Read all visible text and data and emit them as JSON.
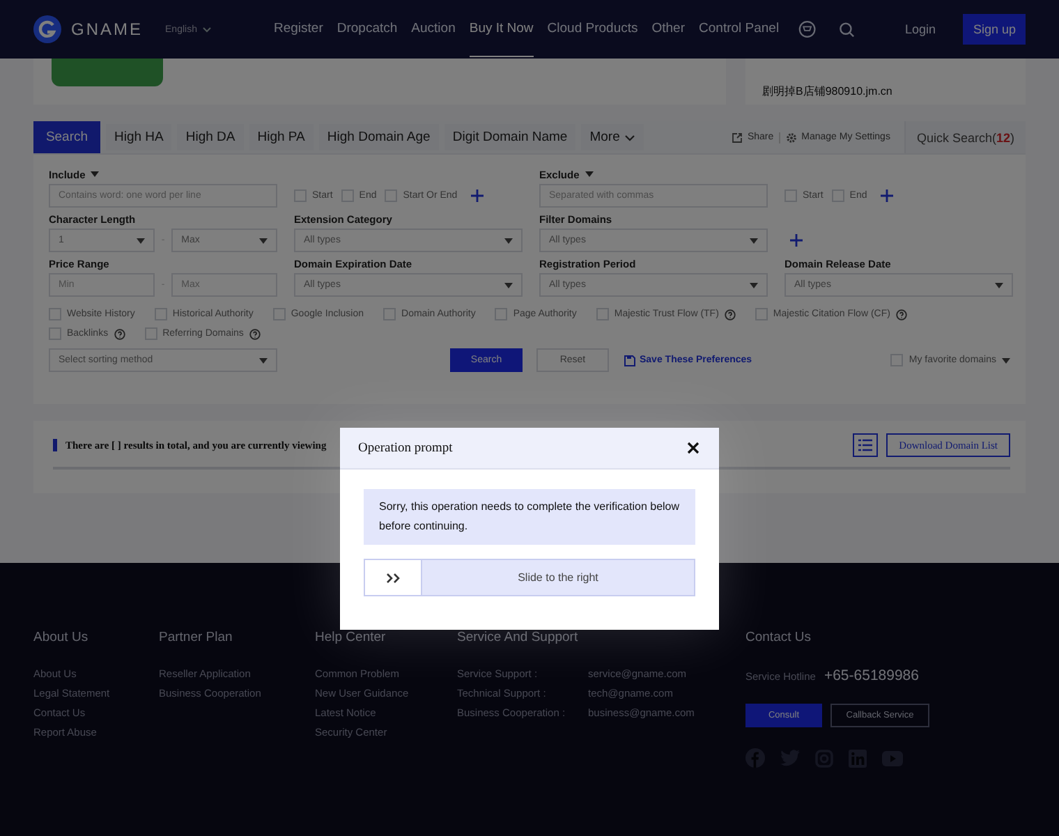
{
  "header": {
    "logo": "GNAME",
    "language": "English",
    "nav": [
      {
        "label": "Register",
        "selected": false
      },
      {
        "label": "Dropcatch",
        "selected": false
      },
      {
        "label": "Auction",
        "selected": false
      },
      {
        "label": "Buy It Now",
        "selected": true
      },
      {
        "label": "Cloud Products",
        "selected": false
      },
      {
        "label": "Other",
        "selected": false
      },
      {
        "label": "Control Panel",
        "selected": false
      }
    ],
    "login": "Login",
    "signup": "Sign up"
  },
  "top_cards": {
    "domain": "剧明掉B店铺980910.jm.cn"
  },
  "search_panel": {
    "tabs": [
      {
        "label": "Search",
        "selected": true
      },
      {
        "label": "High HA",
        "selected": false
      },
      {
        "label": "High DA",
        "selected": false
      },
      {
        "label": "High PA",
        "selected": false
      },
      {
        "label": "High Domain Age",
        "selected": false
      },
      {
        "label": "Digit Domain Name",
        "selected": false
      },
      {
        "label": "More",
        "selected": false
      }
    ],
    "share": "Share",
    "manage": "Manage My Settings",
    "quick_search": [
      {
        "text": "Quick Search(",
        "kind": "plain"
      },
      {
        "text": "12",
        "kind": "count"
      },
      {
        "text": ")",
        "kind": "plain"
      }
    ],
    "include": {
      "label": "Include",
      "placeholder": "Contains word: one word per line",
      "options": [
        {
          "label": "Start",
          "checked": false
        },
        {
          "label": "End",
          "checked": false
        },
        {
          "label": "Start Or End",
          "checked": false
        }
      ]
    },
    "exclude": {
      "label": "Exclude",
      "placeholder": "Separated with commas",
      "options": [
        {
          "label": "Start",
          "checked": false
        },
        {
          "label": "End",
          "checked": false
        }
      ]
    },
    "character_length": {
      "label": "Character Length",
      "from": "1",
      "separator": "-",
      "to": "Max"
    },
    "extension_category": {
      "label": "Extension Category",
      "value": "All types"
    },
    "filter_domains": {
      "label": "Filter Domains",
      "value": "All types"
    },
    "price_range": {
      "label": "Price Range",
      "min_placeholder": "Min",
      "separator": "-",
      "max_placeholder": "Max"
    },
    "domain_expiration_date": {
      "label": "Domain Expiration Date",
      "value": "All types"
    },
    "registration_period": {
      "label": "Registration Period",
      "value": "All types"
    },
    "domain_release_date": {
      "label": "Domain Release Date",
      "value": "All types"
    },
    "metric_rows": [
      {
        "items": [
          {
            "label": "Website History",
            "checked": false,
            "help": false
          },
          {
            "label": "Historical Authority",
            "checked": false,
            "help": false
          },
          {
            "label": "Google Inclusion",
            "checked": false,
            "help": false
          },
          {
            "label": "Domain Authority",
            "checked": false,
            "help": false
          },
          {
            "label": "Page Authority",
            "checked": false,
            "help": false
          },
          {
            "label": "Majestic Trust Flow (TF)",
            "checked": false,
            "help": true
          },
          {
            "label": "Majestic Citation Flow (CF)",
            "checked": false,
            "help": true
          }
        ]
      },
      {
        "items": [
          {
            "label": "Backlinks",
            "checked": false,
            "help": true
          },
          {
            "label": "Referring Domains",
            "checked": false,
            "help": true
          }
        ]
      }
    ],
    "sorting": {
      "placeholder": "Select sorting method"
    },
    "search_button": "Search",
    "reset_button": "Reset",
    "save_preferences": "Save These Preferences",
    "favorite": {
      "label": "My favorite domains",
      "checked": false
    }
  },
  "results": {
    "summary": "There are [ ] results in total, and you are currently viewing",
    "download": "Download Domain List"
  },
  "footer": {
    "columns": [
      {
        "title": "About Us",
        "links": [
          "About Us",
          "Legal Statement",
          "Contact Us",
          "Report Abuse"
        ]
      },
      {
        "title": "Partner Plan",
        "links": [
          "Reseller Application",
          "Business Cooperation"
        ]
      },
      {
        "title": "Help Center",
        "links": [
          "Common Problem",
          "New User Guidance",
          "Latest Notice",
          "Security Center"
        ]
      }
    ],
    "support": {
      "title": "Service And Support",
      "rows": [
        {
          "label": "Service Support :",
          "email": "service@gname.com"
        },
        {
          "label": "Technical Support :",
          "email": "tech@gname.com"
        },
        {
          "label": "Business Cooperation :",
          "email": "business@gname.com"
        }
      ]
    },
    "contact": {
      "title": "Contact Us",
      "hotline_label": "Service Hotline",
      "hotline": "+65-65189986",
      "consult": "Consult",
      "callback": "Callback Service"
    }
  },
  "modal": {
    "title": "Operation prompt",
    "message": "Sorry, this operation needs to complete the verification below before continuing.",
    "slider_label": "Slide to the right"
  }
}
